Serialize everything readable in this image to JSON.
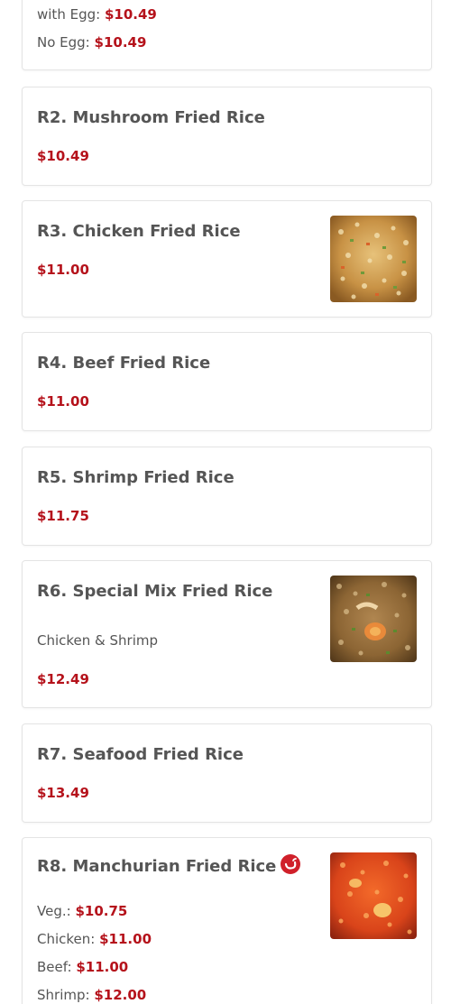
{
  "items": [
    {
      "options": [
        {
          "label": "with Egg:",
          "price": "$10.49"
        },
        {
          "label": "No Egg:",
          "price": "$10.49"
        }
      ]
    },
    {
      "title": "R2. Mushroom Fried Rice",
      "price": "$10.49"
    },
    {
      "title": "R3. Chicken Fried Rice",
      "price": "$11.00",
      "image_icon": "chicken-fried-rice-photo"
    },
    {
      "title": "R4. Beef Fried Rice",
      "price": "$11.00"
    },
    {
      "title": "R5. Shrimp Fried Rice",
      "price": "$11.75"
    },
    {
      "title": "R6. Special Mix Fried Rice",
      "description": "Chicken & Shrimp",
      "price": "$12.49",
      "image_icon": "special-mix-fried-rice-photo"
    },
    {
      "title": "R7. Seafood Fried Rice",
      "price": "$13.49"
    },
    {
      "title": "R8. Manchurian Fried Rice",
      "badge_icon": "spicy-pepper-icon",
      "image_icon": "manchurian-fried-rice-photo",
      "options": [
        {
          "label": "Veg.:",
          "price": "$10.75"
        },
        {
          "label": "Chicken:",
          "price": "$11.00"
        },
        {
          "label": "Beef:",
          "price": "$11.00"
        },
        {
          "label": "Shrimp:",
          "price": "$12.00"
        }
      ]
    }
  ],
  "colors": {
    "price": "#b5121b",
    "text": "#555555",
    "border": "#e4e4e4",
    "spicy_badge": "#d0202a"
  }
}
